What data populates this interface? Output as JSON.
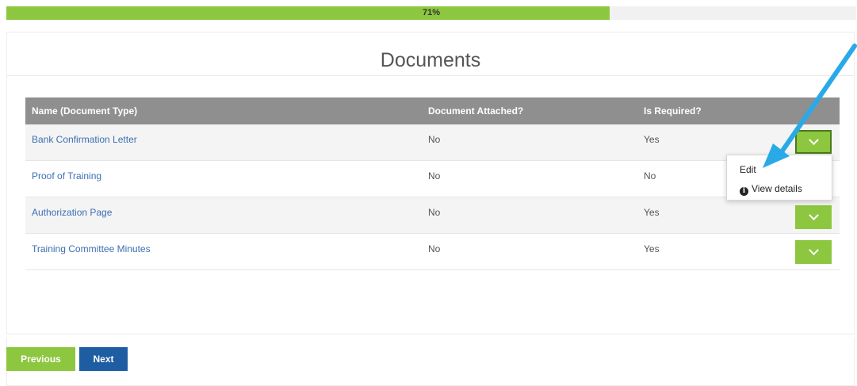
{
  "progress": {
    "label": "71%",
    "fraction": 0.71,
    "color": "#8dc63f"
  },
  "panel": {
    "title": "Documents"
  },
  "table": {
    "headers": [
      "Name (Document Type)",
      "Document Attached?",
      "Is Required?"
    ],
    "rows": [
      {
        "name": "Bank Confirmation Letter",
        "attached": "No",
        "required": "Yes"
      },
      {
        "name": "Proof of Training",
        "attached": "No",
        "required": "No"
      },
      {
        "name": "Authorization Page",
        "attached": "No",
        "required": "Yes"
      },
      {
        "name": "Training Committee Minutes",
        "attached": "No",
        "required": "Yes"
      }
    ]
  },
  "dropdown_menu": {
    "items": [
      {
        "label": "Edit"
      },
      {
        "label": "View details",
        "icon": "info-icon"
      }
    ]
  },
  "footer": {
    "previous_label": "Previous",
    "next_label": "Next"
  },
  "colors": {
    "accent_green": "#8dc63f",
    "primary_blue": "#1f5da2",
    "header_gray": "#8f8f8f",
    "arrow_blue": "#29a9e8"
  }
}
